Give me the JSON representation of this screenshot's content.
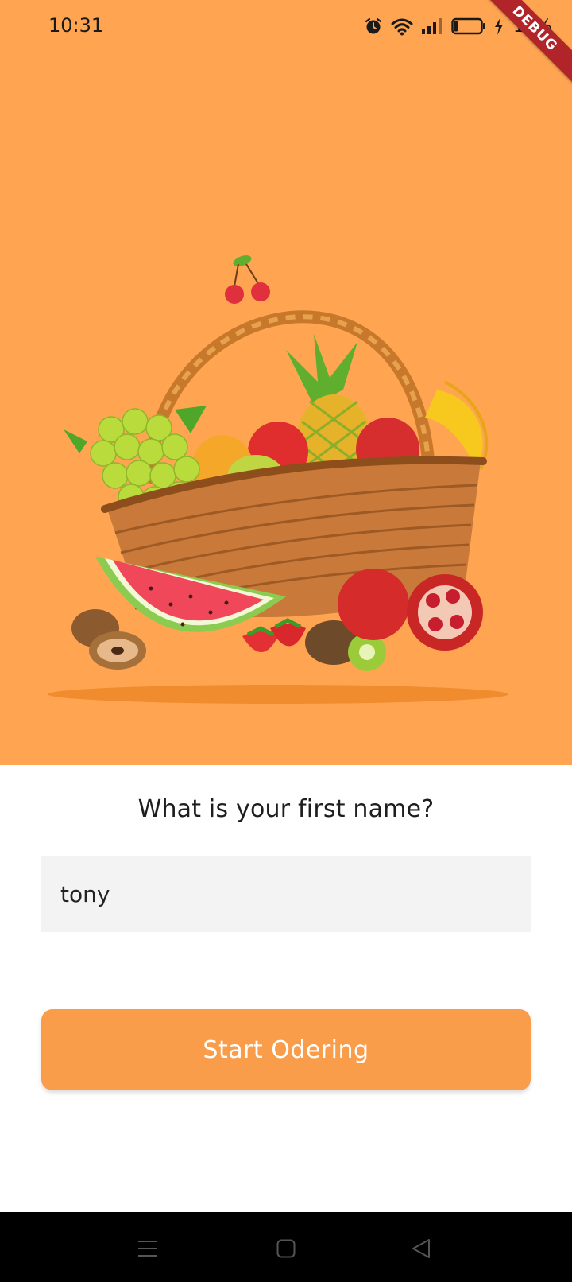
{
  "status_bar": {
    "time": "10:31",
    "battery": "11%",
    "icons": [
      "alarm-icon",
      "wifi-icon",
      "signal-icon",
      "battery-icon",
      "charging-icon"
    ]
  },
  "debug_banner": {
    "label": "DEBUG"
  },
  "hero": {
    "background_color": "#FFA552",
    "image": "fruit-basket-illustration"
  },
  "form": {
    "question": "What is your first name?",
    "name_value": "tony",
    "start_label": "Start Odering"
  },
  "colors": {
    "accent": "#F99D4B",
    "field_background": "#F3F3F3"
  },
  "nav_bar": {
    "icons": [
      "menu-icon",
      "home-icon",
      "back-icon"
    ]
  }
}
